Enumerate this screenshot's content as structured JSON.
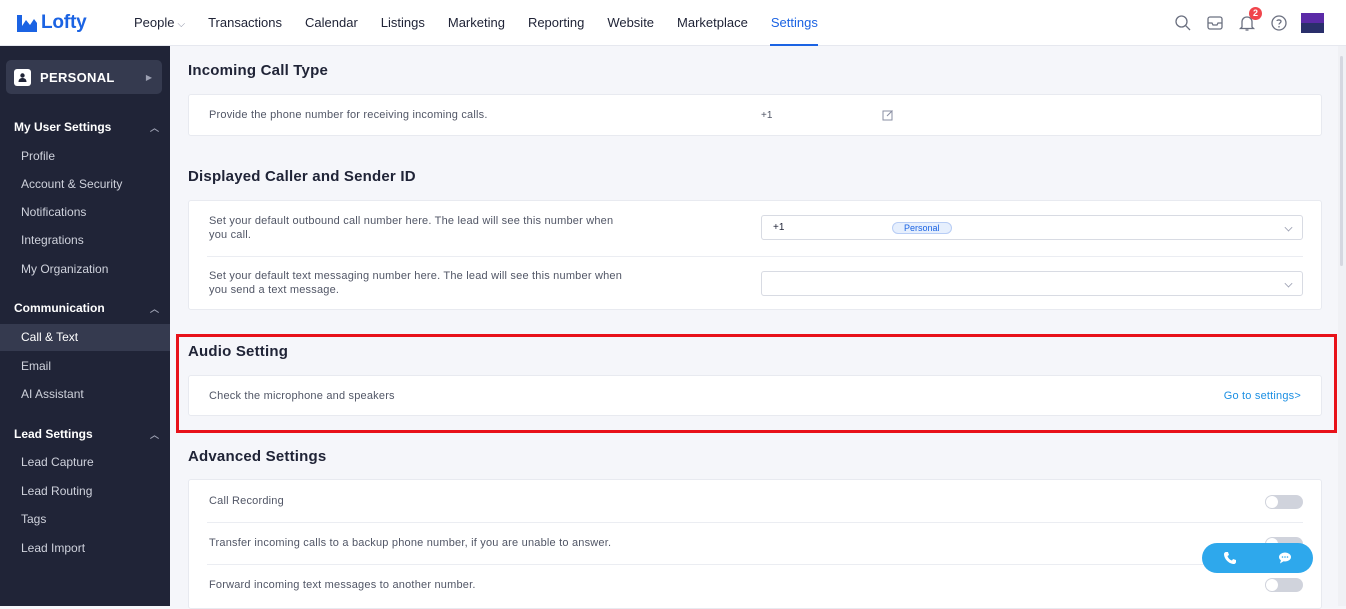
{
  "app": {
    "name": "Lofty"
  },
  "nav": {
    "items": [
      {
        "label": "People",
        "has_dropdown": true
      },
      {
        "label": "Transactions"
      },
      {
        "label": "Calendar"
      },
      {
        "label": "Listings"
      },
      {
        "label": "Marketing"
      },
      {
        "label": "Reporting"
      },
      {
        "label": "Website"
      },
      {
        "label": "Marketplace"
      },
      {
        "label": "Settings",
        "active": true
      }
    ],
    "notification_count": "2",
    "icons": [
      "search-icon",
      "inbox-icon",
      "bell-icon",
      "help-icon"
    ]
  },
  "sidebar": {
    "personal_label": "PERSONAL",
    "sections": [
      {
        "title": "My User Settings",
        "items": [
          "Profile",
          "Account & Security",
          "Notifications",
          "Integrations",
          "My Organization"
        ]
      },
      {
        "title": "Communication",
        "items": [
          "Call & Text",
          "Email",
          "AI Assistant"
        ]
      },
      {
        "title": "Lead Settings",
        "items": [
          "Lead Capture",
          "Lead Routing",
          "Tags",
          "Lead Import"
        ]
      }
    ],
    "active_item": "Call & Text"
  },
  "main": {
    "incoming": {
      "title": "Incoming Call Type",
      "row_text": "Provide the phone number for receiving incoming calls.",
      "phone_prefix": "+1"
    },
    "caller_id": {
      "title": "Displayed Caller and Sender ID",
      "call_text_1": "Set your default outbound call number here. The lead will see this number when",
      "call_text_2": "you call.",
      "call_value": "+1",
      "call_tag": "Personal",
      "text_text_1": "Set your default text messaging number here. The lead will see this number when",
      "text_text_2": "you send a text message.",
      "text_value": ""
    },
    "audio": {
      "title": "Audio Setting",
      "row_text": "Check the microphone and speakers",
      "link": "Go to settings>"
    },
    "advanced": {
      "title": "Advanced Settings",
      "rows": [
        {
          "label": "Call Recording",
          "enabled": false
        },
        {
          "label": "Transfer incoming calls to a backup phone number, if you are unable to answer.",
          "enabled": false
        },
        {
          "label": "Forward incoming text messages to another number.",
          "enabled": false
        }
      ]
    }
  },
  "colors": {
    "brand": "#1b63e3",
    "sidebar_bg": "#202437",
    "highlight": "#e8121a",
    "fab": "#2ea8ec"
  }
}
